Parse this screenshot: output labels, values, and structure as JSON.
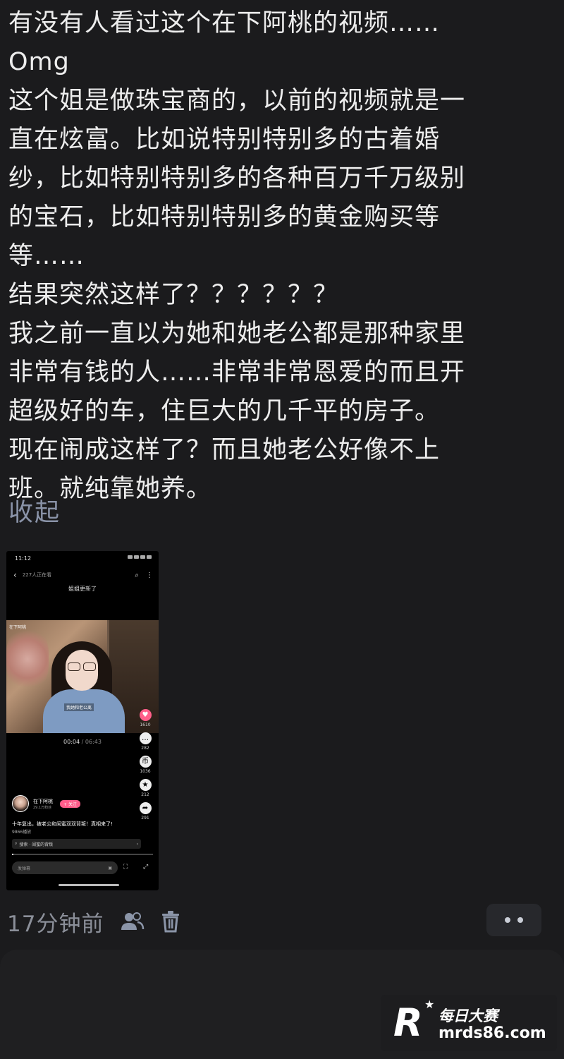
{
  "post": {
    "lines": [
      "有没有人看过这个在下阿桃的视频……",
      "Omg",
      "这个姐是做珠宝商的，以前的视频就是一",
      "直在炫富。比如说特别特别多的古着婚",
      "纱，比如特别特别多的各种百万千万级别",
      "的宝石，比如特别特别多的黄金购买等",
      "等……",
      "结果突然这样了？？？？？？",
      "我之前一直以为她和她老公都是那种家里",
      "非常有钱的人……非常非常恩爱的而且开",
      "超级好的车，住巨大的几千平的房子。",
      "现在闹成这样了？而且她老公好像不上",
      "班。就纯靠她养。"
    ],
    "collapse_label": "收起"
  },
  "screenshot": {
    "status_time": "11:12",
    "watching": "227人正在看",
    "title": "姐姐更新了",
    "video_tag": "在下阿桃",
    "subtitle": "我她和老公离",
    "time_current": "00:04",
    "time_sep": " / ",
    "time_total": "06:43",
    "progress": 0.01,
    "likes": "1610",
    "comments": "282",
    "coins": "1036",
    "favorites": "212",
    "shares": "291",
    "author_name": "在下阿桃",
    "author_fans": "29.1万粉丝",
    "follow_label": "+ 关注",
    "description": "十年复出，被老公和闺蜜双双背叛！真相来了!",
    "views": "9866播放",
    "search_text": "搜索 · 闺蜜的背叛",
    "input_placeholder": "发弹幕"
  },
  "meta": {
    "time": "17分钟前",
    "icons": [
      "people-icon",
      "trash-icon",
      "more-icon"
    ]
  },
  "watermark": {
    "logo": "R",
    "name": "每日大赛",
    "url": "mrds86.com"
  }
}
